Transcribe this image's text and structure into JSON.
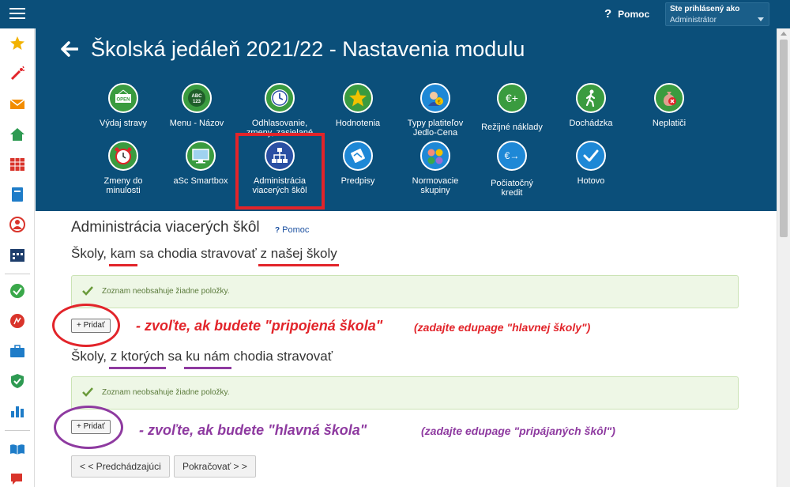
{
  "topbar": {
    "help_label": "Pomoc",
    "user_line1": "Ste prihlásený ako",
    "user_line2": "Administrátor"
  },
  "sidebar": {
    "icons": [
      "star-icon",
      "magic-wand-icon",
      "envelope-icon",
      "home-icon",
      "calendar-grid-icon",
      "book-icon",
      "person-icon",
      "schedule-icon",
      "check-circle-icon",
      "flag-circle-icon",
      "briefcase-icon",
      "shield-check-icon",
      "bar-chart-icon",
      "open-book-icon",
      "chat-icon"
    ]
  },
  "header": {
    "title": "Školská jedáleň 2021/22 - Nastavenia modulu",
    "tiles_row1": [
      {
        "label": "Výdaj stravy",
        "icon": "open-sign-icon"
      },
      {
        "label": "Menu - Názov",
        "icon": "abc-board-icon"
      },
      {
        "label": "Odhlasovanie,",
        "label2": "zmeny, zasielané",
        "icon": "clock-icon"
      },
      {
        "label": "Hodnotenia",
        "icon": "star-icon"
      },
      {
        "label": "Typy platiteľov",
        "label2": "Jedlo-Cena",
        "icon": "payer-icon"
      },
      {
        "label": "Režijné náklady",
        "icon": "euro-plus-icon"
      },
      {
        "label": "Dochádzka",
        "icon": "walking-icon"
      },
      {
        "label": "Neplatiči",
        "icon": "money-bag-icon"
      }
    ],
    "tiles_row2": [
      {
        "label": "Zmeny do",
        "label2": "minulosti",
        "icon": "alarm-clock-icon"
      },
      {
        "label": "aSc Smartbox",
        "icon": "monitor-icon"
      },
      {
        "label": "Administrácia",
        "label2": "viacerých škôl",
        "icon": "hierarchy-icon"
      },
      {
        "label": "Predpisy",
        "icon": "handshake-icon"
      },
      {
        "label": "Normovacie",
        "label2": "skupiny",
        "icon": "groups-icon"
      },
      {
        "label": "Počiatočný",
        "label2": "kredit",
        "icon": "euro-arrow-icon"
      },
      {
        "label": "Hotovo",
        "icon": "checkmark-icon"
      }
    ]
  },
  "content": {
    "section_title": "Administrácia viacerých škôl",
    "help_label": "Pomoc",
    "subhead1": {
      "p1": "Školy, ",
      "p2": "kam",
      "p3": " sa chodia stravovať ",
      "p4": "z našej školy"
    },
    "subhead2": {
      "p1": "Školy, ",
      "p2": "z ktorých",
      "p3": " sa ",
      "p4": "ku nám",
      "p5": " chodia stravovať"
    },
    "empty_notice": "Zoznam neobsahuje žiadne položky.",
    "add_label": "+ Pridať",
    "annotation1_main": "- zvoľte, ak budete \"pripojená škola\"",
    "annotation1_note": "(zadajte edupage \"hlavnej školy\")",
    "annotation2_main": "-  zvoľte, ak budete \"hlavná škola\"",
    "annotation2_note": "(zadajte edupage \"pripájaných škôl\")",
    "prev_label": "< < Predchádzajúci",
    "next_label": "Pokračovať > >"
  }
}
